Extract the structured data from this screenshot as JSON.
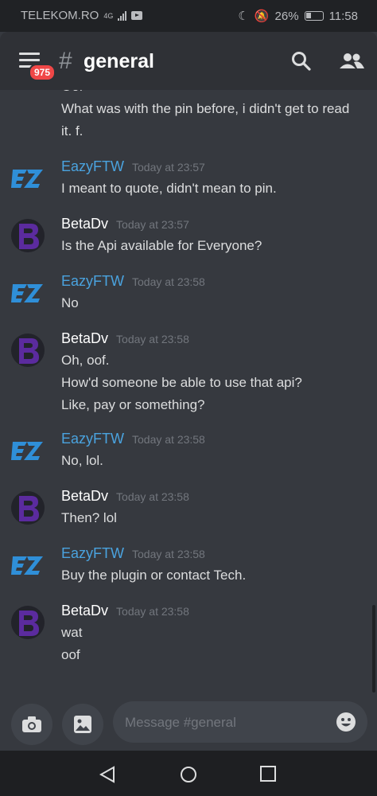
{
  "status": {
    "carrier": "TELEKOM.RO",
    "network": "4G",
    "battery": "26%",
    "time": "11:58"
  },
  "header": {
    "channel": "general",
    "unread_count": "975"
  },
  "messages": [
    {
      "author": "",
      "time": "",
      "avatar": "betadv",
      "lines": [
        "Oof",
        "What was with the pin before, i didn't get to read",
        "it. f."
      ]
    },
    {
      "author": "EazyFTW",
      "time": "Today at 23:57",
      "avatar": "eazyftw",
      "lines": [
        "I meant to quote, didn't mean to pin."
      ]
    },
    {
      "author": "BetaDv",
      "time": "Today at 23:57",
      "avatar": "betadv",
      "lines": [
        "Is the Api available for Everyone?"
      ]
    },
    {
      "author": "EazyFTW",
      "time": "Today at 23:58",
      "avatar": "eazyftw",
      "lines": [
        "No"
      ]
    },
    {
      "author": "BetaDv",
      "time": "Today at 23:58",
      "avatar": "betadv",
      "lines": [
        "Oh, oof.",
        "How'd someone be able to use that api?",
        "Like, pay or something?"
      ]
    },
    {
      "author": "EazyFTW",
      "time": "Today at 23:58",
      "avatar": "eazyftw",
      "lines": [
        "No, lol."
      ]
    },
    {
      "author": "BetaDv",
      "time": "Today at 23:58",
      "avatar": "betadv",
      "lines": [
        "Then? lol"
      ]
    },
    {
      "author": "EazyFTW",
      "time": "Today at 23:58",
      "avatar": "eazyftw",
      "lines": [
        "Buy the plugin or contact Tech."
      ]
    },
    {
      "author": "BetaDv",
      "time": "Today at 23:58",
      "avatar": "betadv",
      "lines": [
        "wat",
        "oof"
      ]
    }
  ],
  "composer": {
    "placeholder": "Message #general"
  },
  "colors": {
    "eazyftw": "#4aa3df",
    "betadv": "#ffffff",
    "accent": "#7289da",
    "badge": "#f04747"
  },
  "icons": [
    "camera-icon",
    "image-icon",
    "emoji-icon",
    "search-icon",
    "members-icon",
    "menu-icon",
    "back-icon",
    "home-icon",
    "recents-icon"
  ]
}
